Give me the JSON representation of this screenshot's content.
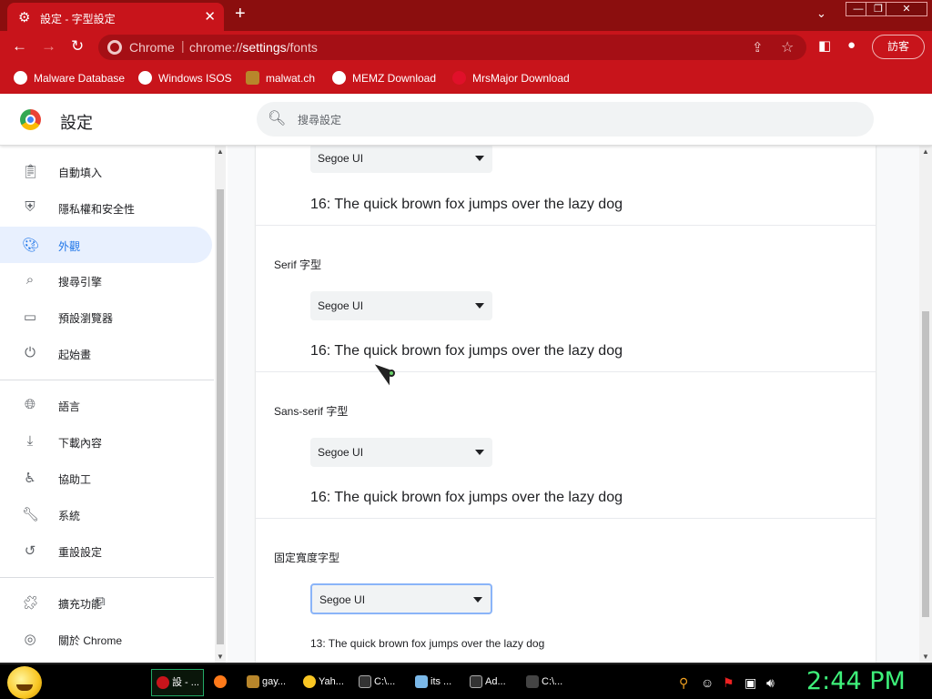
{
  "window": {
    "tab_title": "設定 - 字型設定",
    "new_tab_symbol": "+",
    "tab_dropdown_symbol": "⌄",
    "minimize_symbol": "—",
    "maximize_symbol": "❐",
    "close_symbol": "✕"
  },
  "toolbar": {
    "site_chip": "Chrome",
    "separator": "|",
    "url_prefix": "chrome://",
    "url_path": "settings",
    "url_suffix": "/fonts",
    "profile_label": "訪客"
  },
  "bookmarks": [
    {
      "label": "Malware Database",
      "icon": "globe-icon"
    },
    {
      "label": "Windows ISOS",
      "icon": "globe-icon"
    },
    {
      "label": "malwat.ch",
      "icon": "bag-icon"
    },
    {
      "label": "MEMZ Download",
      "icon": "globe-icon"
    },
    {
      "label": "MrsMajor Download",
      "icon": "heart-icon"
    }
  ],
  "header": {
    "title": "設定",
    "search_placeholder": "搜尋設定"
  },
  "sidebar": {
    "items": [
      {
        "label": "自動填入",
        "icon": "clipboard-icon",
        "active": false
      },
      {
        "label": "隱私權和安全性",
        "icon": "shield-icon",
        "active": false
      },
      {
        "label": "外觀",
        "icon": "palette-icon",
        "active": true
      },
      {
        "label": "搜尋引擎",
        "icon": "search-icon",
        "active": false
      },
      {
        "label": "預設瀏覽器",
        "icon": "browser-icon",
        "active": false
      },
      {
        "label": "起始畫",
        "icon": "power-icon",
        "active": false
      },
      {
        "label": "語言",
        "icon": "globe-icon",
        "active": false
      },
      {
        "label": "下載內容",
        "icon": "download-icon",
        "active": false
      },
      {
        "label": "協助工",
        "icon": "accessibility-icon",
        "active": false
      },
      {
        "label": "系統",
        "icon": "wrench-icon",
        "active": false
      },
      {
        "label": "重設設定",
        "icon": "history-icon",
        "active": false
      },
      {
        "label": "擴充功能",
        "icon": "puzzle-icon",
        "active": false
      },
      {
        "label": "關於 Chrome",
        "icon": "chrome-icon",
        "active": false
      }
    ]
  },
  "fonts": {
    "standard": {
      "value": "Segoe UI",
      "sample": "16: The quick brown fox jumps over the lazy dog"
    },
    "serif": {
      "label": "Serif 字型",
      "value": "Segoe UI",
      "sample": "16: The quick brown fox jumps over the lazy dog"
    },
    "sans_serif": {
      "label": "Sans-serif 字型",
      "value": "Segoe UI",
      "sample": "16: The quick brown fox jumps over the lazy dog"
    },
    "fixed_width": {
      "label": "固定寬度字型",
      "value": "Segoe UI",
      "sample": "13: The quick brown fox jumps over the lazy dog"
    }
  },
  "taskbar": {
    "tasks": [
      {
        "label": "設 - ...",
        "icon": "chrome-icon",
        "active": true
      },
      {
        "label": "",
        "icon": "firefox-icon",
        "active": false
      },
      {
        "label": "gay...",
        "icon": "document-icon",
        "active": false
      },
      {
        "label": "Yah...",
        "icon": "smiley-icon",
        "active": false
      },
      {
        "label": "C:\\...",
        "icon": "cmd-icon",
        "active": false
      },
      {
        "label": "its ...",
        "icon": "notepad-icon",
        "active": false
      },
      {
        "label": "Ad...",
        "icon": "cmd-icon",
        "active": false
      },
      {
        "label": "C:\\...",
        "icon": "7zip-icon",
        "active": false
      }
    ],
    "clock": "2:44 PM"
  },
  "colors": {
    "browser_dark": "#8b0e0e",
    "browser_accent": "#c8141b",
    "active_nav_bg": "#e8f0fe",
    "active_nav_fg": "#1a73e8",
    "clock": "#3ef07a"
  }
}
